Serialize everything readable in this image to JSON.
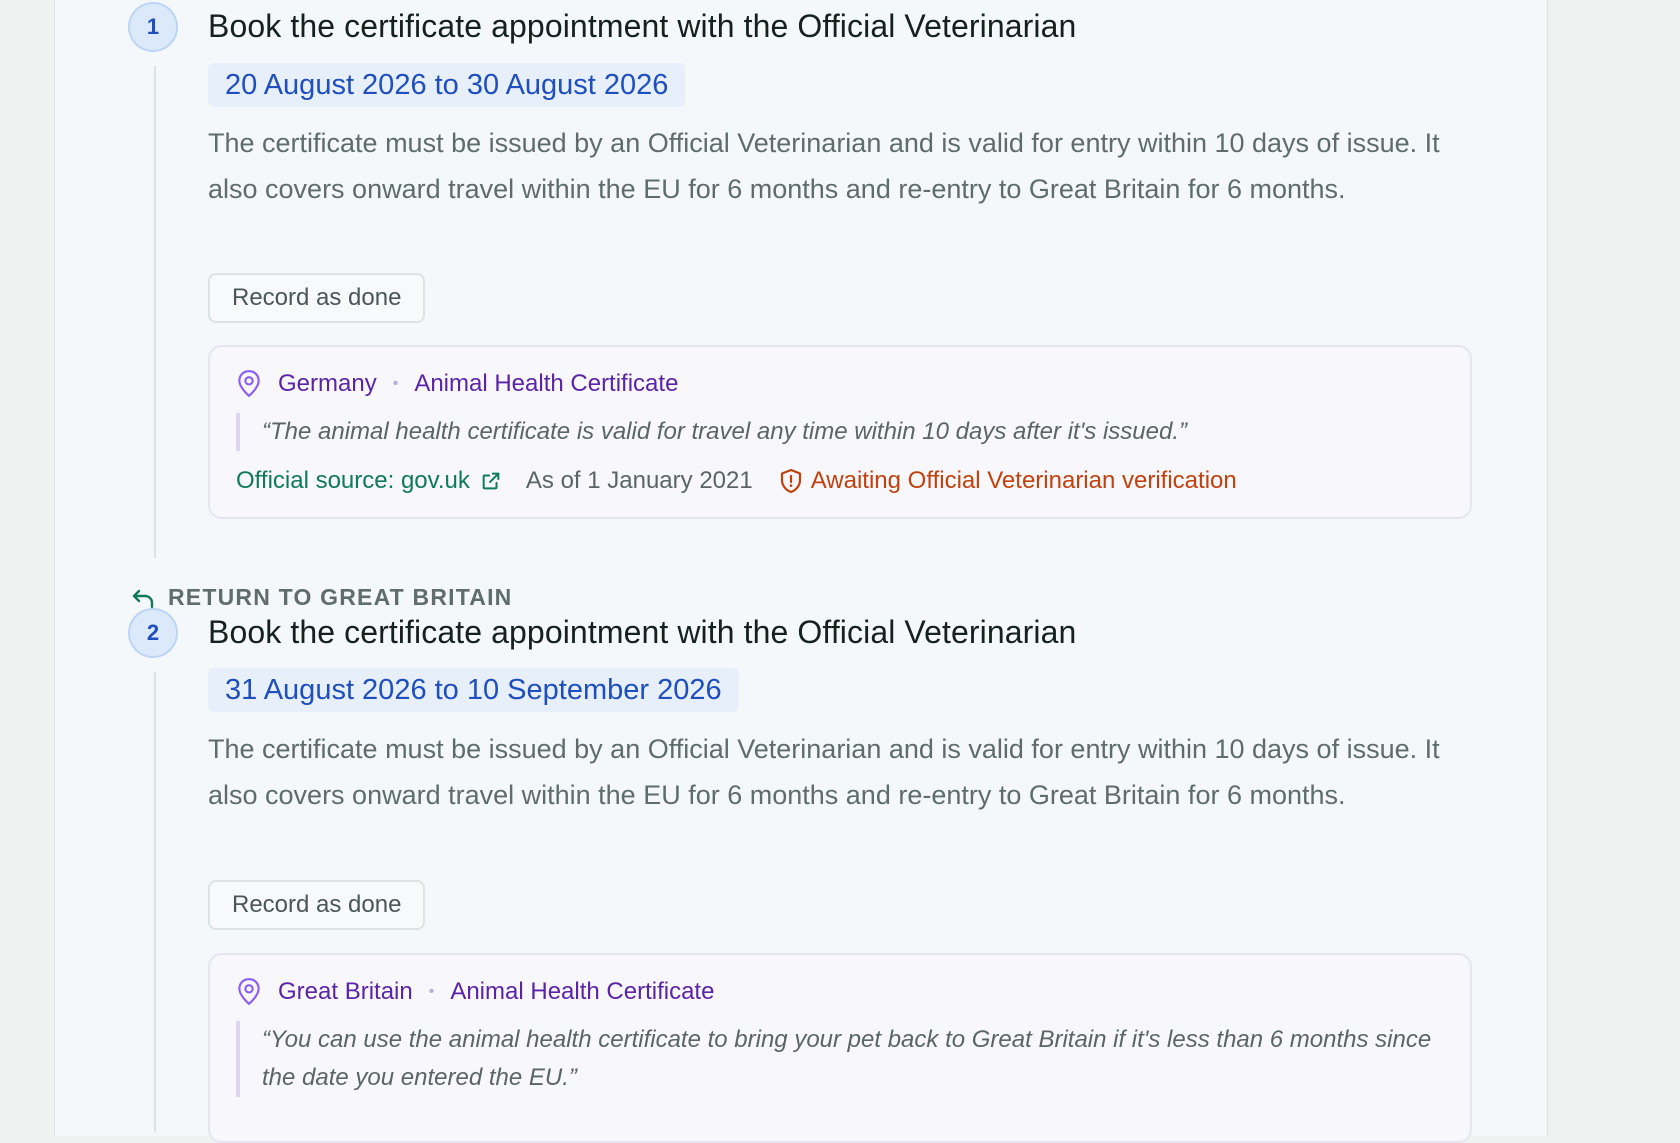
{
  "steps": [
    {
      "number": "1",
      "title": "Book the certificate appointment with the Official Veterinarian",
      "date_range": "20 August 2026 to 30 August 2026",
      "description": "The certificate must be issued by an Official Veterinarian and is valid for entry within 10 days of issue. It also covers onward travel within the EU for 6 months and re-entry to Great Britain for 6 months.",
      "button_label": "Record as done",
      "source": {
        "country": "Germany",
        "document": "Animal Health Certificate",
        "quote": "“The animal health certificate is valid for travel any time within 10 days after it's issued.”",
        "official_source": "Official source: gov.uk",
        "as_of": "As of 1 January 2021",
        "status": "Awaiting Official Veterinarian verification"
      }
    },
    {
      "section_label": "RETURN TO GREAT BRITAIN",
      "number": "2",
      "title": "Book the certificate appointment with the Official Veterinarian",
      "date_range": "31 August 2026 to 10 September 2026",
      "description": "The certificate must be issued by an Official Veterinarian and is valid for entry within 10 days of issue. It also covers onward travel within the EU for 6 months and re-entry to Great Britain for 6 months.",
      "button_label": "Record as done",
      "source": {
        "country": "Great Britain",
        "document": "Animal Health Certificate",
        "quote": "“You can use the animal health certificate to bring your pet back to Great Britain if it's less than 6 months since the date you entered the EU.”"
      }
    }
  ],
  "colors": {
    "accent_blue": "#1f4fbf",
    "source_purple": "#5b23a8",
    "official_green": "#0f7a5c",
    "warning_orange": "#c2410c"
  },
  "icons": [
    "location-pin-icon",
    "external-link-icon",
    "shield-icon",
    "return-arrow-icon"
  ]
}
